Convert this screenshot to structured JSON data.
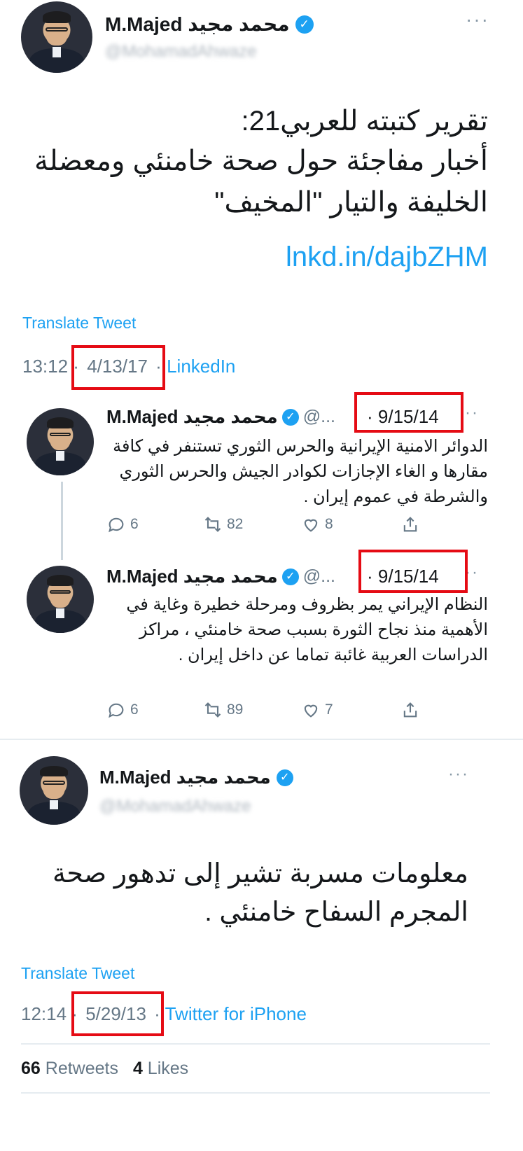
{
  "tweet1": {
    "display_name": "M.Majed محمد مجيد",
    "handle": "@MohamadAhwaze",
    "text_line1": "تقرير كتبته للعربي21:",
    "text_line2": "أخبار مفاجئة حول صحة خامنئي ومعضلة",
    "text_line3": "الخليفة والتيار \"المخيف\"",
    "link": "lnkd.in/dajbZHM",
    "translate": "Translate Tweet",
    "time": "13:12 ·",
    "date": "4/13/17",
    "source_sep": "·",
    "source": "LinkedIn"
  },
  "reply1": {
    "display_name": "M.Majed محمد مجيد",
    "handle": "@...",
    "date": "· 9/15/14",
    "text": "الدوائر الامنية الإيرانية والحرس الثوري تستنفر في كافة مقارها و الغاء الإجازات لكوادر الجيش والحرس الثوري والشرطة في عموم إيران .",
    "replies": "6",
    "retweets": "82",
    "likes": "8"
  },
  "reply2": {
    "display_name": "M.Majed محمد مجيد",
    "handle": "@...",
    "date": "· 9/15/14",
    "text": "النظام الإيراني يمر بظروف ومرحلة خطيرة وغاية في الأهمية منذ نجاح الثورة بسبب صحة خامنئي ، مراكز الدراسات العربية غائبة تماما عن داخل إيران .",
    "replies": "6",
    "retweets": "89",
    "likes": "7"
  },
  "tweet2": {
    "display_name": "M.Majed محمد مجيد",
    "handle": "@MohamadAhwaze",
    "text_line1": "معلومات مسربة تشير إلى تدهور صحة",
    "text_line2": "المجرم السفاح خامنئي .",
    "translate": "Translate Tweet",
    "time": "12:14 ·",
    "date": "5/29/13",
    "source_sep": "·",
    "source": "Twitter for iPhone",
    "retweets_count": "66",
    "retweets_label": "Retweets",
    "likes_count": "4",
    "likes_label": "Likes"
  },
  "colors": {
    "accent": "#1da1f2",
    "highlight": "#e50b14",
    "muted": "#657786"
  },
  "icons": [
    "verified-icon",
    "more-icon",
    "reply-icon",
    "retweet-icon",
    "like-icon",
    "share-icon"
  ]
}
